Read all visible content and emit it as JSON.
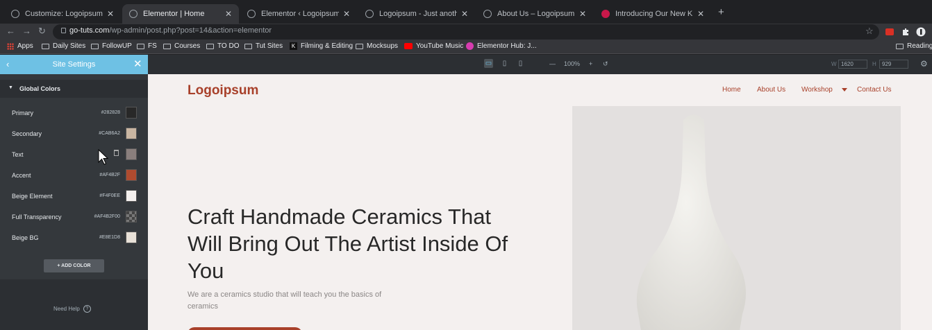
{
  "tabs": [
    {
      "title": "Customize: Logoipsum – Just a",
      "active": false
    },
    {
      "title": "Elementor | Home",
      "active": true
    },
    {
      "title": "Elementor ‹ Logoipsum — Wor",
      "active": false
    },
    {
      "title": "Logoipsum - Just another Wor",
      "active": false
    },
    {
      "title": "About Us – Logoipsum",
      "active": false
    },
    {
      "title": "Introducing Our New Kits Libra",
      "active": false
    }
  ],
  "address": {
    "domain": "go-tuts.com",
    "path": "/wp-admin/post.php?post=14&action=elementor"
  },
  "bookmarks": [
    "Apps",
    "Daily Sites",
    "FollowUP",
    "FS",
    "Courses",
    "TO DO",
    "Tut Sites",
    "Filming & Editing",
    "Mocksups",
    "YouTube Music",
    "Elementor Hub: J...",
    "Reading"
  ],
  "panel": {
    "title": "Site Settings",
    "section_title": "Global Colors",
    "colors": [
      {
        "name": "Primary",
        "hex": "#282828",
        "swatch": "#282828"
      },
      {
        "name": "Secondary",
        "hex": "#CAB6A2",
        "swatch": "#CAB6A2"
      },
      {
        "name": "Text",
        "hex": "",
        "swatch": "#8a7f7d"
      },
      {
        "name": "Accent",
        "hex": "#AF4B2F",
        "swatch": "#AF4B2F"
      },
      {
        "name": "Beige Element",
        "hex": "#F4F0EE",
        "swatch": "#F4F0EE"
      },
      {
        "name": "Full Transparency",
        "hex": "#AF4B2F00",
        "swatch": "transparent"
      },
      {
        "name": "Beige BG",
        "hex": "#E8E1D8",
        "swatch": "#E8E1D8"
      }
    ],
    "add_color": "+ ADD COLOR",
    "need_help": "Need Help"
  },
  "toolbar": {
    "zoom": "100%",
    "w_label": "W",
    "w_value": "1620",
    "h_label": "H",
    "h_value": "929"
  },
  "site": {
    "logo": "Logoipsum",
    "nav": [
      "Home",
      "About Us",
      "Workshop",
      "Contact Us"
    ],
    "headline": "Craft Handmade Ceramics That Will Bring Out The Artist Inside Of You",
    "subtext": "We are a ceramics studio that will teach you the basics of ceramics"
  },
  "colors": {
    "panel_bg": "#34383c",
    "header": "#6ec1e4",
    "accent": "#a8402a",
    "canvas_bg": "#f4f0ef"
  }
}
